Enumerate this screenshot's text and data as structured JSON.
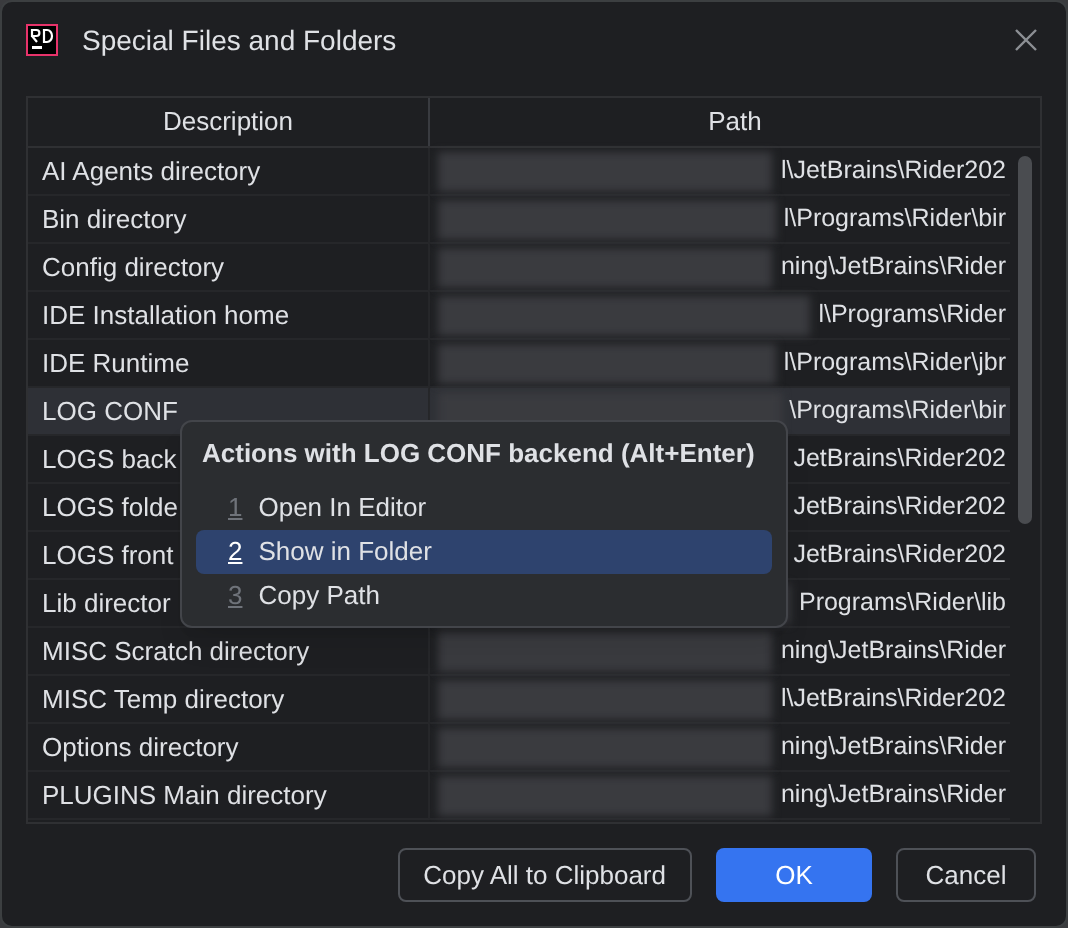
{
  "window": {
    "title": "Special Files and Folders"
  },
  "table": {
    "columns": [
      "Description",
      "Path"
    ],
    "rows": [
      {
        "description": "AI Agents directory",
        "path": "l\\JetBrains\\Rider202",
        "selected": false
      },
      {
        "description": "Bin directory",
        "path": "l\\Programs\\Rider\\bir",
        "selected": false
      },
      {
        "description": "Config directory",
        "path": "ning\\JetBrains\\Rider",
        "selected": false
      },
      {
        "description": "IDE Installation home",
        "path": "l\\Programs\\Rider",
        "selected": false
      },
      {
        "description": "IDE Runtime",
        "path": "l\\Programs\\Rider\\jbr",
        "selected": false
      },
      {
        "description": "LOG CONF",
        "path": "\\Programs\\Rider\\bir",
        "selected": true
      },
      {
        "description": "LOGS back",
        "path": "JetBrains\\Rider202",
        "selected": false
      },
      {
        "description": "LOGS folde",
        "path": "JetBrains\\Rider202",
        "selected": false
      },
      {
        "description": "LOGS front",
        "path": "JetBrains\\Rider202",
        "selected": false
      },
      {
        "description": "Lib director",
        "path": "Programs\\Rider\\lib",
        "selected": false
      },
      {
        "description": "MISC Scratch directory",
        "path": "ning\\JetBrains\\Rider",
        "selected": false
      },
      {
        "description": "MISC Temp directory",
        "path": "l\\JetBrains\\Rider202",
        "selected": false
      },
      {
        "description": "Options directory",
        "path": "ning\\JetBrains\\Rider",
        "selected": false
      },
      {
        "description": "PLUGINS Main directory",
        "path": "ning\\JetBrains\\Rider",
        "selected": false
      }
    ]
  },
  "popup": {
    "title": "Actions with LOG CONF backend (Alt+Enter)",
    "items": [
      {
        "number": "1",
        "label": "Open In Editor",
        "selected": false
      },
      {
        "number": "2",
        "label": "Show in Folder",
        "selected": true
      },
      {
        "number": "3",
        "label": "Copy Path",
        "selected": false
      }
    ]
  },
  "buttons": [
    {
      "label": "Copy All to Clipboard",
      "kind": "secondary"
    },
    {
      "label": "OK",
      "kind": "primary"
    },
    {
      "label": "Cancel",
      "kind": "secondary"
    }
  ]
}
